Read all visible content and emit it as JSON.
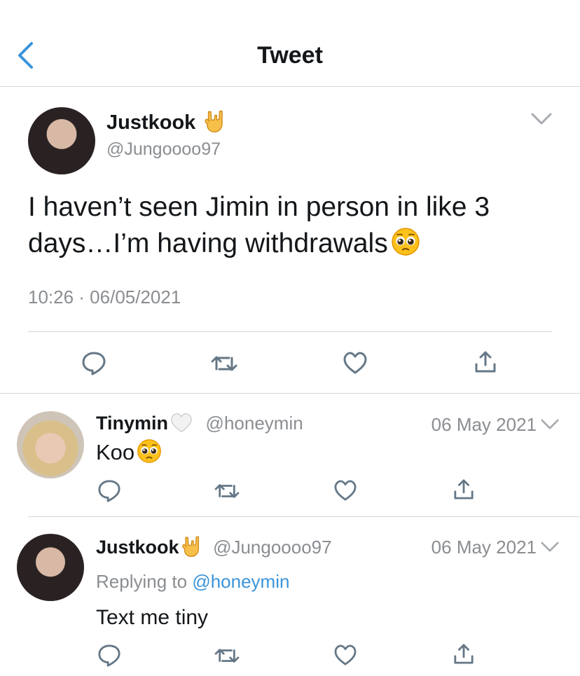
{
  "header": {
    "title": "Tweet",
    "back_icon": "chevron-left-icon"
  },
  "main_tweet": {
    "display_name": "Justkook",
    "name_emoji": "🤟",
    "handle": "@Jungoooo97",
    "text": "I haven’t seen Jimin in person in like 3 days…I’m having withdrawals",
    "text_emoji": "🥺",
    "timestamp": "10:26 · 06/05/2021"
  },
  "replies": [
    {
      "display_name": "Tinymin",
      "name_emoji": "🤍",
      "handle": "@honeymin",
      "date": "06 May 2021",
      "text": "Koo",
      "text_emoji": "🥺"
    },
    {
      "display_name": "Justkook",
      "name_emoji": "🤟",
      "handle": "@Jungoooo97",
      "date": "06 May 2021",
      "replying_to_label": "Replying to",
      "replying_to_handle": "@honeymin",
      "text": "Text me tiny"
    }
  ],
  "icons": [
    "reply-icon",
    "retweet-icon",
    "like-icon",
    "share-icon",
    "chevron-down-icon"
  ],
  "colors": {
    "link": "#3b94d9",
    "muted": "#8a8d91",
    "icon": "#657786",
    "divider": "#d3d6d9"
  }
}
